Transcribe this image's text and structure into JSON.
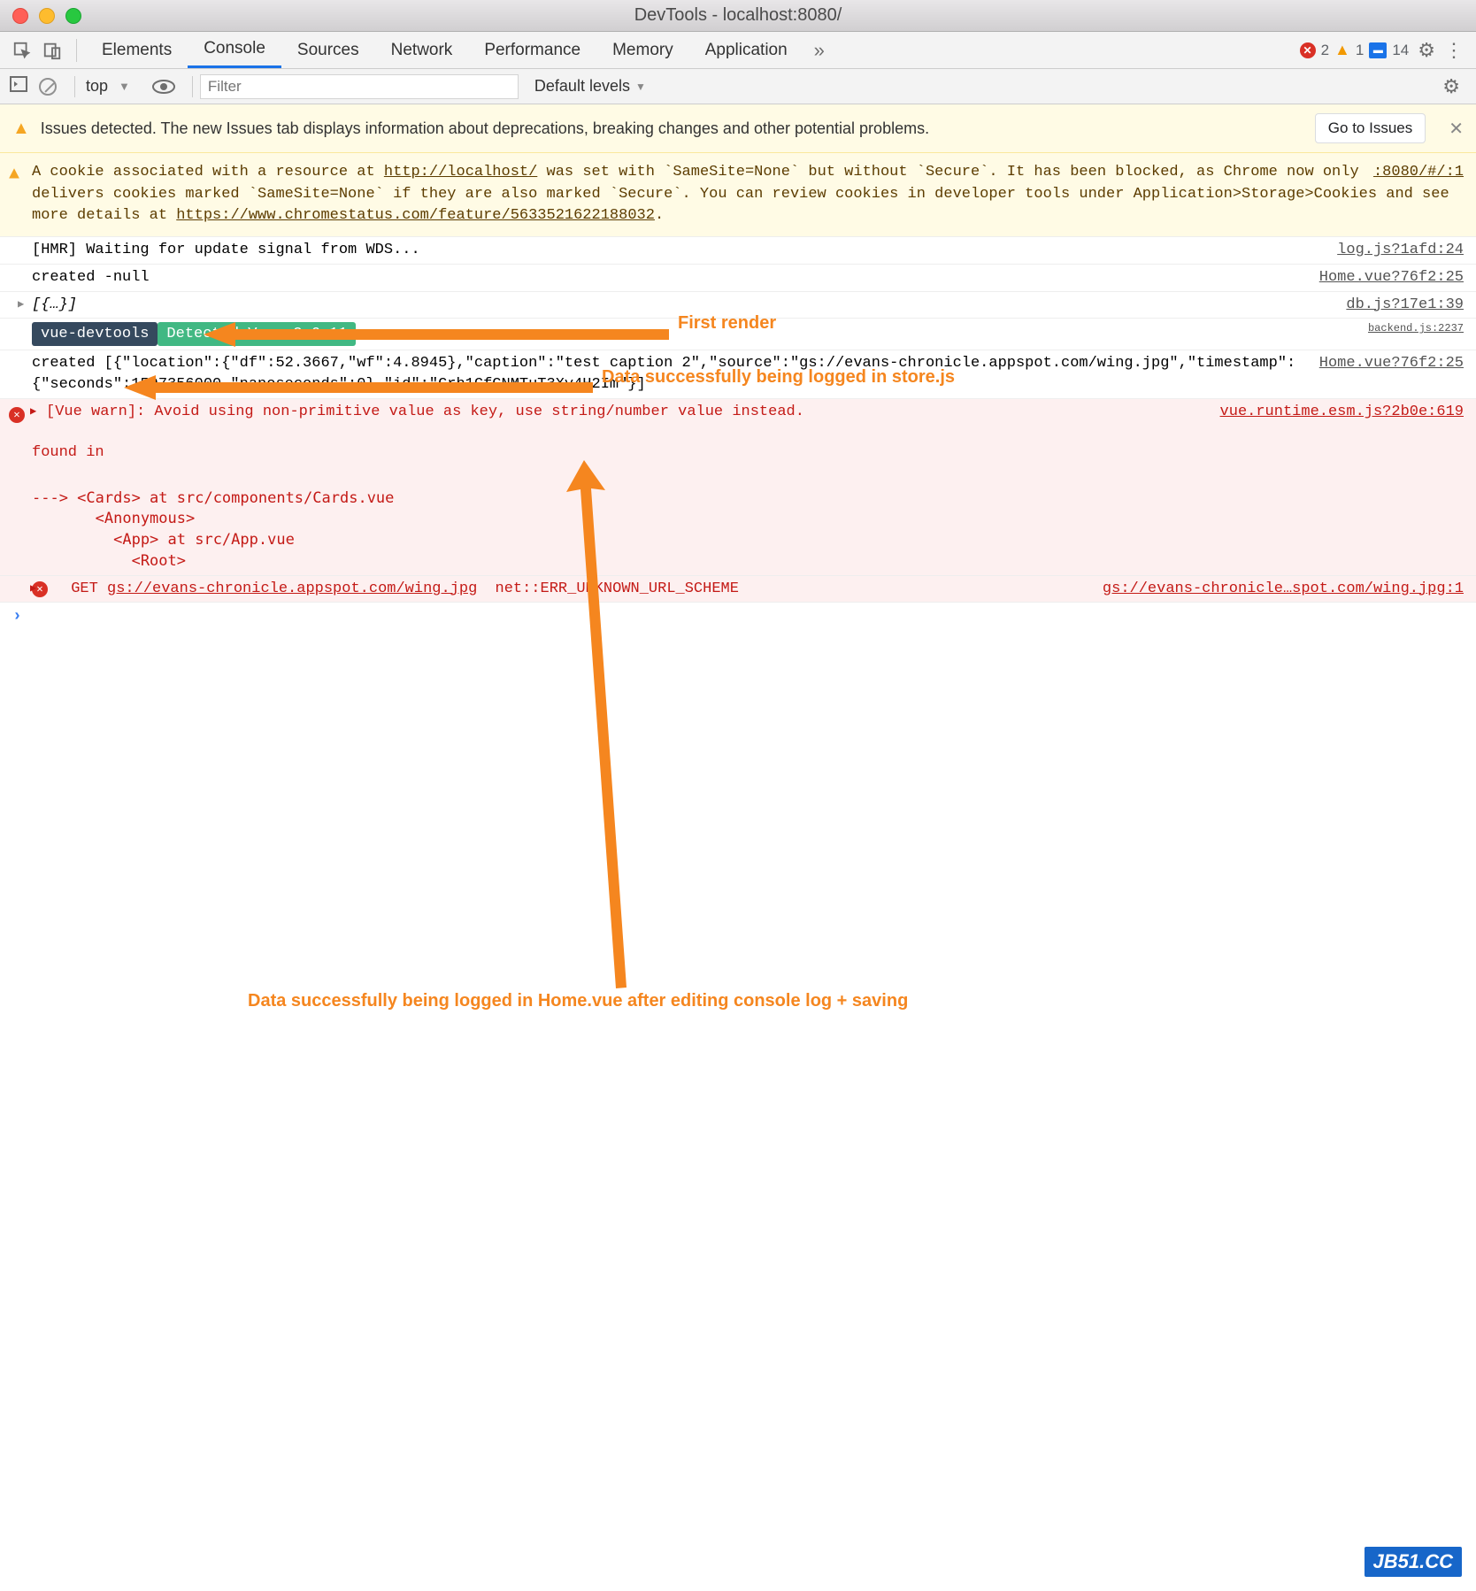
{
  "window": {
    "title": "DevTools - localhost:8080/"
  },
  "tabs": {
    "elements": "Elements",
    "console": "Console",
    "sources": "Sources",
    "network": "Network",
    "performance": "Performance",
    "memory": "Memory",
    "application": "Application"
  },
  "counts": {
    "errors": "2",
    "warnings": "1",
    "info": "14"
  },
  "toolbar": {
    "context": "top",
    "filter_placeholder": "Filter",
    "levels_label": "Default levels"
  },
  "issues": {
    "text": "Issues detected. The new Issues tab displays information about deprecations, breaking changes and other potential problems.",
    "go_button": "Go to Issues"
  },
  "cookie": {
    "prefix": "A cookie associated with a resource at ",
    "url": "http://localhost/",
    "mid": " was set with `SameSite=None` but without `Secure`.  It has been blocked, as Chrome now only delivers cookies marked `SameSite=None` if they are also marked `Secure`. You can review cookies in developer tools under Application>Storage>Cookies and see more details at ",
    "link2": "https://www.chromestatus.com/feature/5633521622188032",
    "suffix": ".",
    "src": ":8080/#/:1"
  },
  "rows": {
    "hmr": {
      "text": "[HMR] Waiting for update signal from WDS...",
      "src": "log.js?1afd:24"
    },
    "created_null": {
      "text": "created -null",
      "src": "Home.vue?76f2:25"
    },
    "obj": {
      "text": "[{…}]",
      "src": "db.js?17e1:39"
    },
    "devtools_a": "vue-devtools",
    "devtools_b": " Detected Vue v2.6.11 ",
    "devtools_src": "backend.js:2237",
    "created_obj": {
      "text": "created [{\"location\":{\"df\":52.3667,\"wf\":4.8945},\"caption\":\"test caption 2\",\"source\":\"gs://evans-chronicle.appspot.com/wing.jpg\",\"timestamp\":{\"seconds\":1597356000,\"nanoseconds\":0},\"id\":\"Grh1CfGNMTuT3Xy4H2Im\"}]",
      "src": "Home.vue?76f2:25"
    },
    "vue_warn": {
      "line1": "[Vue warn]: Avoid using non-primitive value as key, use string/number value instead.",
      "src": "vue.runtime.esm.js?2b0e:619",
      "found": "found in",
      "trace": "---> <Cards> at src/components/Cards.vue\n       <Anonymous>\n         <App> at src/App.vue\n           <Root>"
    },
    "net_err": {
      "method": "GET",
      "url": "gs://evans-chronicle.appspot.com/wing.jpg",
      "code": "net::ERR_UNKNOWN_URL_SCHEME",
      "src": "gs://evans-chronicle…spot.com/wing.jpg:1"
    }
  },
  "annotations": {
    "first_render": "First render",
    "store": "Data successfully being logged in store.js",
    "home": "Data successfully being logged in Home.vue after editing console log + saving"
  },
  "watermark": "JB51.CC"
}
